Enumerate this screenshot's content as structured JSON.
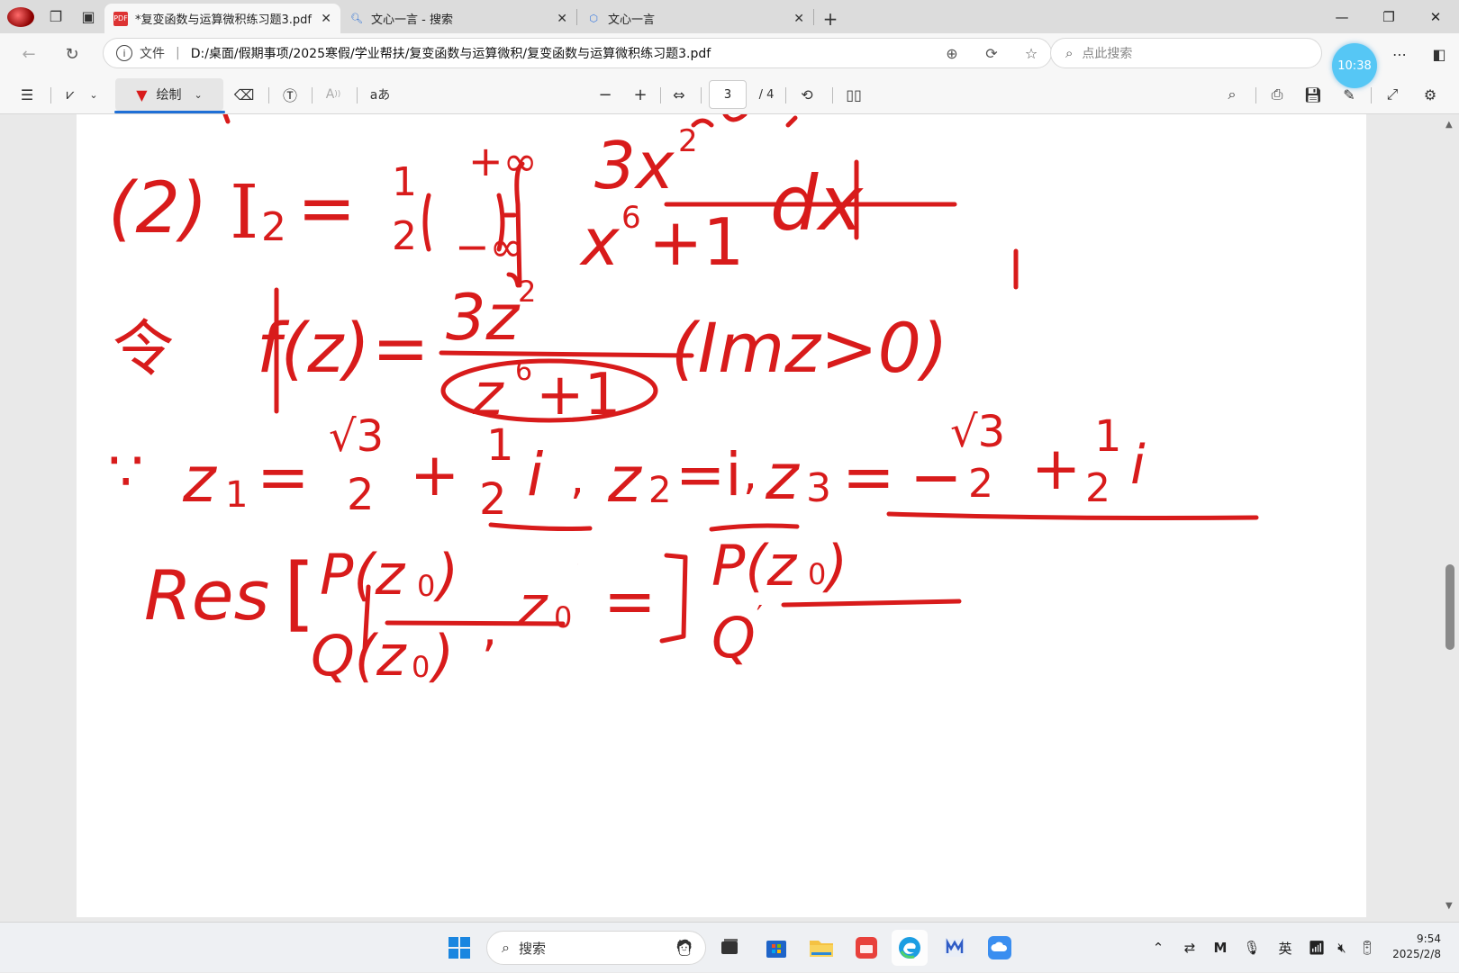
{
  "tabs": [
    {
      "title": "*复变函数与运算微积练习题3.pdf",
      "icon": "pdf-icon",
      "active": true
    },
    {
      "title": "文心一言 - 搜索",
      "icon": "search-icon",
      "active": false
    },
    {
      "title": "文心一言",
      "icon": "cube-icon",
      "active": false
    }
  ],
  "address": {
    "file_label": "文件",
    "separator": "|",
    "url": "D:/桌面/假期事项/2025寒假/学业帮扶/复变函数与运算微积/复变函数与运算微积练习题3.pdf",
    "search_placeholder": "点此搜索"
  },
  "overlay_clock": "10:38",
  "toolbar": {
    "draw_label": "绘制",
    "read_aloud_label": "A",
    "text_label": "aあ",
    "zoom_out": "−",
    "zoom_in": "+",
    "page_current": "3",
    "page_total": "/ 4"
  },
  "handwriting": {
    "line1": [
      "(2)",
      "I",
      "2",
      "=",
      "1",
      "2",
      "+∞",
      "−∞",
      "3x",
      "2",
      "x",
      "6",
      "+1",
      "dx"
    ],
    "line2": [
      "令",
      "f(z)",
      "=",
      "3z",
      "2",
      "z",
      "6",
      "+1",
      "(Imz>0)"
    ],
    "line3": [
      "∵",
      "z",
      "1",
      "=",
      "√3",
      "2",
      "+",
      "1",
      "2",
      "i",
      ",",
      "z",
      "2",
      "=i",
      ",",
      "z",
      "3",
      "=",
      "−",
      "√3",
      "2",
      "+",
      "1",
      "2",
      "i"
    ],
    "line4": [
      "Res",
      "[",
      "P(z",
      "0",
      ")",
      "Q(z",
      "0",
      ")",
      ",",
      "z",
      "0",
      "]",
      "=",
      "P(z",
      "0",
      ")",
      "Q",
      "′"
    ]
  },
  "taskbar": {
    "search_text": "搜索",
    "ime": "英",
    "time": "9:54",
    "date": "2025/2/8"
  },
  "colors": {
    "ink": "#d81b1b",
    "accent": "#1f6fd6"
  }
}
